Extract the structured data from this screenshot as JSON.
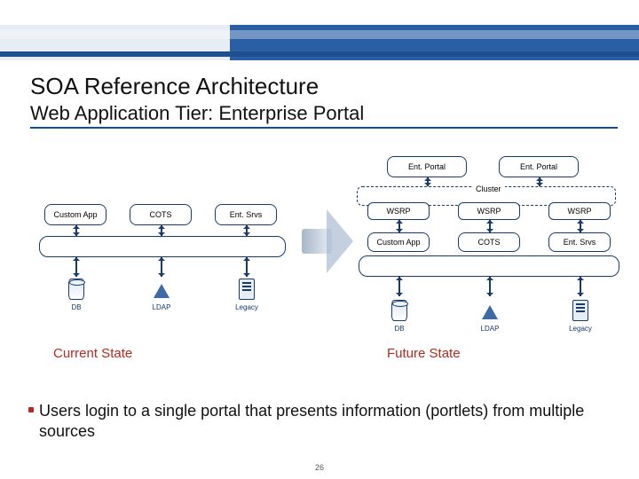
{
  "title": "SOA Reference Architecture",
  "subtitle": "Web Application Tier: Enterprise Portal",
  "diagram": {
    "left": {
      "apps": [
        "Custom App",
        "COTS",
        "Ent. Srvs"
      ],
      "stores": [
        "DB",
        "LDAP",
        "Legacy"
      ],
      "state_label": "Current State"
    },
    "right": {
      "portals": [
        "Ent. Portal",
        "Ent. Portal"
      ],
      "cluster_label": "Cluster",
      "wsrp": [
        "WSRP",
        "WSRP",
        "WSRP"
      ],
      "apps": [
        "Custom App",
        "COTS",
        "Ent. Srvs"
      ],
      "stores": [
        "DB",
        "LDAP",
        "Legacy"
      ],
      "state_label": "Future State"
    }
  },
  "bullet": "Users login to a single portal that presents information (portlets) from multiple sources",
  "page_number": "26"
}
